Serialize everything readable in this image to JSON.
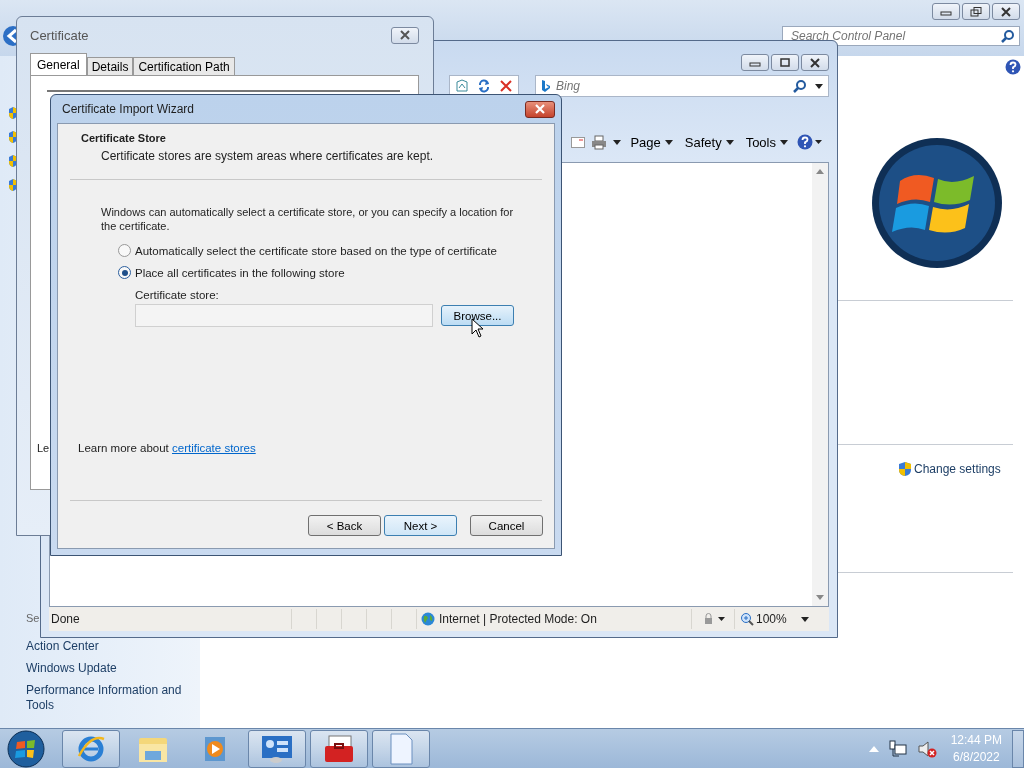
{
  "control_panel": {
    "search": {
      "placeholder": "Search Control Panel"
    },
    "see_also_heading": "Se",
    "links": [
      "Action Center",
      "Windows Update",
      "Performance Information and Tools"
    ],
    "change_settings": "Change settings"
  },
  "browser": {
    "search": {
      "placeholder": "Bing"
    },
    "commands": [
      "Page",
      "Safety",
      "Tools"
    ],
    "status": "Done",
    "zone": "Internet | Protected Mode: On",
    "zoom": "100%"
  },
  "certificate_dialog": {
    "title": "Certificate",
    "tabs": [
      {
        "label": "General",
        "selected": true
      },
      {
        "label": "Details",
        "selected": false
      },
      {
        "label": "Certification Path",
        "selected": false
      }
    ],
    "fragment": "Le"
  },
  "wizard": {
    "title": "Certificate Import Wizard",
    "heading": "Certificate Store",
    "subheading": "Certificate stores are system areas where certificates are kept.",
    "intro": "Windows can automatically select a certificate store, or you can specify a location for the certificate.",
    "options": [
      {
        "label": "Automatically select the certificate store based on the type of certificate",
        "selected": false
      },
      {
        "label": "Place all certificates in the following store",
        "selected": true
      }
    ],
    "store_label": "Certificate store:",
    "browse": "Browse...",
    "learn_more": {
      "text": "Learn more about",
      "link": "certificate stores"
    },
    "buttons": [
      {
        "label": "< Back",
        "default": false
      },
      {
        "label": "Next >",
        "default": true
      },
      {
        "label": "Cancel",
        "default": false
      }
    ]
  },
  "taskbar": {
    "time": "12:44 PM",
    "date": "6/8/2022"
  }
}
